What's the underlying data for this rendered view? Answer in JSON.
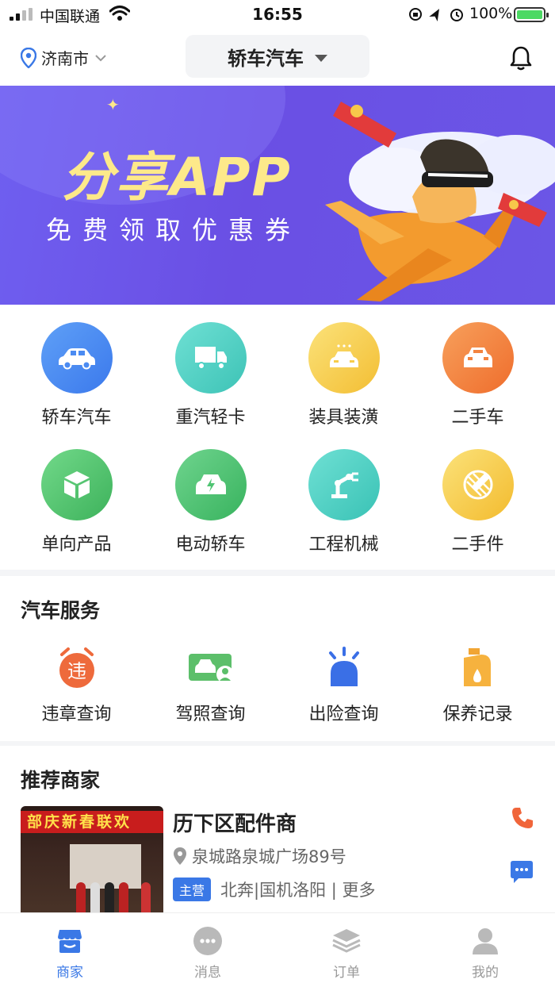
{
  "status_bar": {
    "carrier": "中国联通",
    "time": "16:55",
    "battery": "100%"
  },
  "header": {
    "city": "济南市",
    "category": "轿车汽车"
  },
  "banner": {
    "title": "分享APP",
    "subtitle": "免费领取优惠券"
  },
  "categories": [
    {
      "label": "轿车汽车",
      "icon": "sedan-icon",
      "color": "#4b8bf2"
    },
    {
      "label": "重汽轻卡",
      "icon": "truck-icon",
      "color": "#4cd1c4"
    },
    {
      "label": "装具装潢",
      "icon": "car-decoration-icon",
      "color": "#f7cc4a"
    },
    {
      "label": "二手车",
      "icon": "used-car-icon",
      "color": "#f3833f"
    },
    {
      "label": "单向产品",
      "icon": "box-icon",
      "color": "#55c56e"
    },
    {
      "label": "电动轿车",
      "icon": "electric-car-icon",
      "color": "#4fc472"
    },
    {
      "label": "工程机械",
      "icon": "robot-arm-icon",
      "color": "#4dcfc5"
    },
    {
      "label": "二手件",
      "icon": "parts-icon",
      "color": "#f6c63f"
    }
  ],
  "services": {
    "title": "汽车服务",
    "items": [
      {
        "label": "违章查询",
        "icon": "violation-clock-icon",
        "glyph": "违"
      },
      {
        "label": "驾照查询",
        "icon": "license-icon"
      },
      {
        "label": "出险查询",
        "icon": "siren-icon"
      },
      {
        "label": "保养记录",
        "icon": "oil-can-icon"
      }
    ]
  },
  "merchants": {
    "title": "推荐商家",
    "items": [
      {
        "name": "历下区配件商",
        "address": "泉城路泉城广场89号",
        "badge": "主营",
        "brands": "北奔|国机洛阳 | 更多",
        "photo_banner_text": "部庆新春联欢"
      }
    ]
  },
  "tabs": [
    {
      "label": "商家",
      "icon": "store-icon",
      "active": true
    },
    {
      "label": "消息",
      "icon": "message-icon",
      "active": false
    },
    {
      "label": "订单",
      "icon": "orders-layers-icon",
      "active": false
    },
    {
      "label": "我的",
      "icon": "profile-icon",
      "active": false
    }
  ],
  "colors": {
    "accent": "#3a78e6",
    "banner_bg": "#6a4fe4",
    "phone": "#f0653a",
    "chat": "#3a78e6"
  }
}
